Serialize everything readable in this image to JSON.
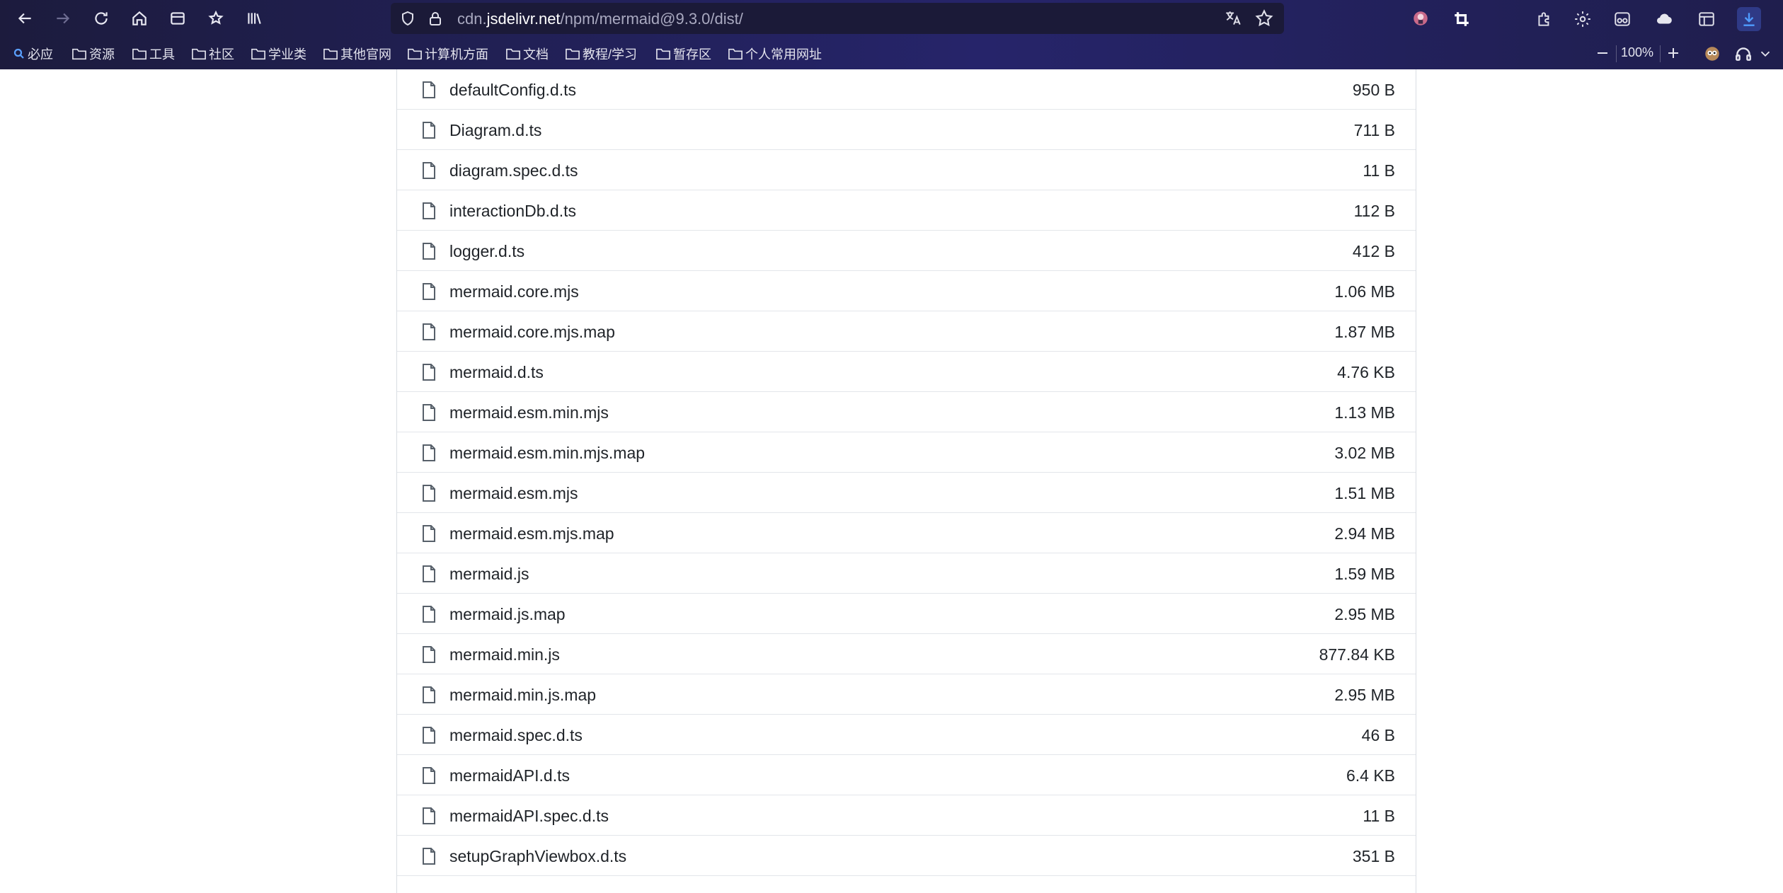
{
  "browser": {
    "url_prefix": "cdn.",
    "url_domain": "jsdelivr.net",
    "url_path": "/npm/mermaid@9.3.0/dist/",
    "zoom": "100%",
    "bookmarks": [
      {
        "label": "必应",
        "icon": "search-icon"
      },
      {
        "label": "资源",
        "icon": "folder-icon"
      },
      {
        "label": "工具",
        "icon": "folder-icon"
      },
      {
        "label": "社区",
        "icon": "folder-icon"
      },
      {
        "label": "学业类",
        "icon": "folder-icon"
      },
      {
        "label": "其他官网",
        "icon": "folder-icon"
      },
      {
        "label": "计算机方面",
        "icon": "folder-icon"
      },
      {
        "label": "文档",
        "icon": "folder-icon"
      },
      {
        "label": "教程/学习",
        "icon": "folder-icon"
      },
      {
        "label": "暂存区",
        "icon": "folder-icon"
      },
      {
        "label": "个人常用网址",
        "icon": "folder-icon"
      }
    ]
  },
  "files": [
    {
      "name": "defaultConfig.d.ts",
      "size": "950 B"
    },
    {
      "name": "Diagram.d.ts",
      "size": "711 B"
    },
    {
      "name": "diagram.spec.d.ts",
      "size": "11 B"
    },
    {
      "name": "interactionDb.d.ts",
      "size": "112 B"
    },
    {
      "name": "logger.d.ts",
      "size": "412 B"
    },
    {
      "name": "mermaid.core.mjs",
      "size": "1.06 MB"
    },
    {
      "name": "mermaid.core.mjs.map",
      "size": "1.87 MB"
    },
    {
      "name": "mermaid.d.ts",
      "size": "4.76 KB"
    },
    {
      "name": "mermaid.esm.min.mjs",
      "size": "1.13 MB"
    },
    {
      "name": "mermaid.esm.min.mjs.map",
      "size": "3.02 MB"
    },
    {
      "name": "mermaid.esm.mjs",
      "size": "1.51 MB"
    },
    {
      "name": "mermaid.esm.mjs.map",
      "size": "2.94 MB"
    },
    {
      "name": "mermaid.js",
      "size": "1.59 MB"
    },
    {
      "name": "mermaid.js.map",
      "size": "2.95 MB"
    },
    {
      "name": "mermaid.min.js",
      "size": "877.84 KB"
    },
    {
      "name": "mermaid.min.js.map",
      "size": "2.95 MB"
    },
    {
      "name": "mermaid.spec.d.ts",
      "size": "46 B"
    },
    {
      "name": "mermaidAPI.d.ts",
      "size": "6.4 KB"
    },
    {
      "name": "mermaidAPI.spec.d.ts",
      "size": "11 B"
    },
    {
      "name": "setupGraphViewbox.d.ts",
      "size": "351 B"
    }
  ]
}
